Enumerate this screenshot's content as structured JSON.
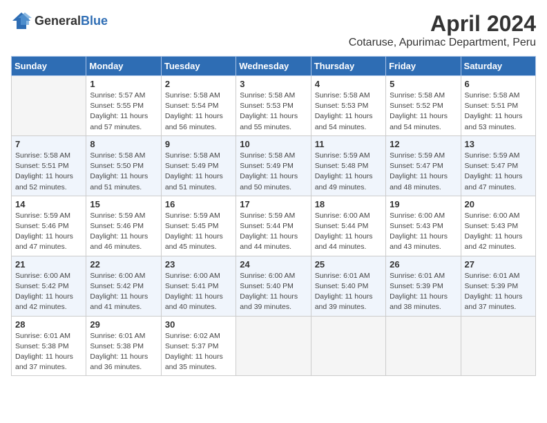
{
  "logo": {
    "general": "General",
    "blue": "Blue"
  },
  "title": "April 2024",
  "subtitle": "Cotaruse, Apurimac Department, Peru",
  "headers": [
    "Sunday",
    "Monday",
    "Tuesday",
    "Wednesday",
    "Thursday",
    "Friday",
    "Saturday"
  ],
  "weeks": [
    [
      {
        "day": "",
        "info": ""
      },
      {
        "day": "1",
        "sunrise": "5:57 AM",
        "sunset": "5:55 PM",
        "daylight": "11 hours and 57 minutes."
      },
      {
        "day": "2",
        "sunrise": "5:58 AM",
        "sunset": "5:54 PM",
        "daylight": "11 hours and 56 minutes."
      },
      {
        "day": "3",
        "sunrise": "5:58 AM",
        "sunset": "5:53 PM",
        "daylight": "11 hours and 55 minutes."
      },
      {
        "day": "4",
        "sunrise": "5:58 AM",
        "sunset": "5:53 PM",
        "daylight": "11 hours and 54 minutes."
      },
      {
        "day": "5",
        "sunrise": "5:58 AM",
        "sunset": "5:52 PM",
        "daylight": "11 hours and 54 minutes."
      },
      {
        "day": "6",
        "sunrise": "5:58 AM",
        "sunset": "5:51 PM",
        "daylight": "11 hours and 53 minutes."
      }
    ],
    [
      {
        "day": "7",
        "sunrise": "5:58 AM",
        "sunset": "5:51 PM",
        "daylight": "11 hours and 52 minutes."
      },
      {
        "day": "8",
        "sunrise": "5:58 AM",
        "sunset": "5:50 PM",
        "daylight": "11 hours and 51 minutes."
      },
      {
        "day": "9",
        "sunrise": "5:58 AM",
        "sunset": "5:49 PM",
        "daylight": "11 hours and 51 minutes."
      },
      {
        "day": "10",
        "sunrise": "5:58 AM",
        "sunset": "5:49 PM",
        "daylight": "11 hours and 50 minutes."
      },
      {
        "day": "11",
        "sunrise": "5:59 AM",
        "sunset": "5:48 PM",
        "daylight": "11 hours and 49 minutes."
      },
      {
        "day": "12",
        "sunrise": "5:59 AM",
        "sunset": "5:47 PM",
        "daylight": "11 hours and 48 minutes."
      },
      {
        "day": "13",
        "sunrise": "5:59 AM",
        "sunset": "5:47 PM",
        "daylight": "11 hours and 47 minutes."
      }
    ],
    [
      {
        "day": "14",
        "sunrise": "5:59 AM",
        "sunset": "5:46 PM",
        "daylight": "11 hours and 47 minutes."
      },
      {
        "day": "15",
        "sunrise": "5:59 AM",
        "sunset": "5:46 PM",
        "daylight": "11 hours and 46 minutes."
      },
      {
        "day": "16",
        "sunrise": "5:59 AM",
        "sunset": "5:45 PM",
        "daylight": "11 hours and 45 minutes."
      },
      {
        "day": "17",
        "sunrise": "5:59 AM",
        "sunset": "5:44 PM",
        "daylight": "11 hours and 44 minutes."
      },
      {
        "day": "18",
        "sunrise": "6:00 AM",
        "sunset": "5:44 PM",
        "daylight": "11 hours and 44 minutes."
      },
      {
        "day": "19",
        "sunrise": "6:00 AM",
        "sunset": "5:43 PM",
        "daylight": "11 hours and 43 minutes."
      },
      {
        "day": "20",
        "sunrise": "6:00 AM",
        "sunset": "5:43 PM",
        "daylight": "11 hours and 42 minutes."
      }
    ],
    [
      {
        "day": "21",
        "sunrise": "6:00 AM",
        "sunset": "5:42 PM",
        "daylight": "11 hours and 42 minutes."
      },
      {
        "day": "22",
        "sunrise": "6:00 AM",
        "sunset": "5:42 PM",
        "daylight": "11 hours and 41 minutes."
      },
      {
        "day": "23",
        "sunrise": "6:00 AM",
        "sunset": "5:41 PM",
        "daylight": "11 hours and 40 minutes."
      },
      {
        "day": "24",
        "sunrise": "6:00 AM",
        "sunset": "5:40 PM",
        "daylight": "11 hours and 39 minutes."
      },
      {
        "day": "25",
        "sunrise": "6:01 AM",
        "sunset": "5:40 PM",
        "daylight": "11 hours and 39 minutes."
      },
      {
        "day": "26",
        "sunrise": "6:01 AM",
        "sunset": "5:39 PM",
        "daylight": "11 hours and 38 minutes."
      },
      {
        "day": "27",
        "sunrise": "6:01 AM",
        "sunset": "5:39 PM",
        "daylight": "11 hours and 37 minutes."
      }
    ],
    [
      {
        "day": "28",
        "sunrise": "6:01 AM",
        "sunset": "5:38 PM",
        "daylight": "11 hours and 37 minutes."
      },
      {
        "day": "29",
        "sunrise": "6:01 AM",
        "sunset": "5:38 PM",
        "daylight": "11 hours and 36 minutes."
      },
      {
        "day": "30",
        "sunrise": "6:02 AM",
        "sunset": "5:37 PM",
        "daylight": "11 hours and 35 minutes."
      },
      {
        "day": "",
        "info": ""
      },
      {
        "day": "",
        "info": ""
      },
      {
        "day": "",
        "info": ""
      },
      {
        "day": "",
        "info": ""
      }
    ]
  ]
}
